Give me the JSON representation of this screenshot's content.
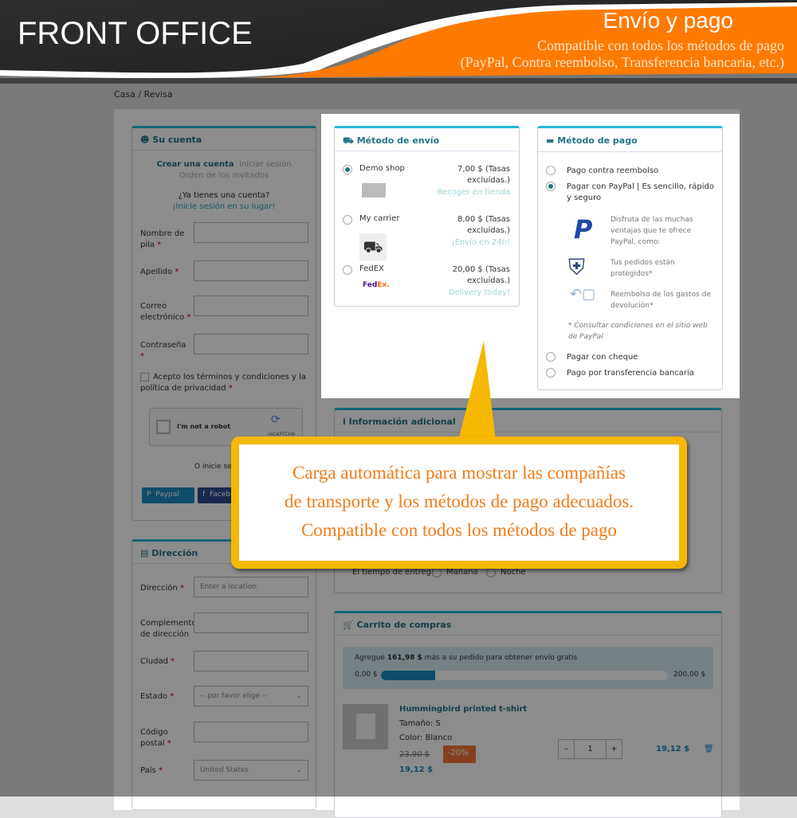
{
  "header": {
    "title": "FRONT OFFICE",
    "feature": "Envío y pago",
    "subtitle_line1": "Compatible con todos los métodos de pago",
    "subtitle_line2": "(PayPal, Contra reembolso, Transferencia bancaria, etc.)"
  },
  "breadcrumb": {
    "home": "Casa",
    "sep": "/",
    "current": "Revisa"
  },
  "account": {
    "title": "Su cuenta",
    "tab_create": "Crear una cuenta",
    "tab_login": "Iniciar sesión",
    "tab_guest": "Orden de los invitados",
    "have_account": "¿Ya tienes una cuenta?",
    "login_link": "¡Inicie sesión en su lugar!",
    "fields": [
      {
        "label": "Nombre de pila"
      },
      {
        "label": "Apellido"
      },
      {
        "label": "Correo electrónico"
      },
      {
        "label": "Contraseña"
      }
    ],
    "terms": "Acepto los términos y condiciones y la política de privacidad",
    "captcha_label": "I'm not a robot",
    "captcha_brand": "reCAPTCHA",
    "social_prompt": "O inicie sesión con",
    "paypal_btn": "Paypal",
    "facebook_btn": "Facebook"
  },
  "address": {
    "title": "Dirección",
    "fields": [
      {
        "label": "Dirección",
        "placeholder": "Enter a location"
      },
      {
        "label": "Complemento de dirección"
      },
      {
        "label": "Ciudad"
      },
      {
        "label": "Estado",
        "value": "-- por favor elige --"
      },
      {
        "label": "Código postal"
      },
      {
        "label": "País",
        "value": "United States"
      }
    ]
  },
  "shipping": {
    "title": "Método de envío",
    "carriers": [
      {
        "name": "Demo shop",
        "price": "7,00 $ (Tasas excluídas.)",
        "delay": "Recoger en tienda",
        "selected": true
      },
      {
        "name": "My carrier",
        "price": "8,00 $ (Tasas excluídas.)",
        "delay": "¡Envío en 24h!",
        "selected": false
      },
      {
        "name": "FedEX",
        "price": "20,00 $ (Tasas excluídas.)",
        "delay": "Delivery today!",
        "selected": false,
        "logo": "FedEx."
      }
    ]
  },
  "payment": {
    "title": "Método de pago",
    "options": [
      "Pago contra reembolso",
      "Pagar con PayPal | Es sencillo, rápido y seguro",
      "Pagar con cheque",
      "Pago por transferencia bancaria"
    ],
    "selected": 1,
    "paypal_info": [
      "Disfruta de las muchas ventajas que te ofrece PayPal, como:",
      "Tus pedidos están protegidos*",
      "Reembolso de los gastos de devolución*"
    ],
    "paypal_note": "* Consultar condiciones en el sitio web de PayPal"
  },
  "additional": {
    "title": "Información adicional",
    "delivery_time_label": "El tiempo de entrega",
    "options": [
      "Mañana",
      "Noche"
    ]
  },
  "cart": {
    "title": "Carrito de compras",
    "free_ship_pre": "Agregue ",
    "free_ship_amount": "161,98 $",
    "free_ship_post": " más a su pedido para obtener envío gratis",
    "progress_min": "0,00 $",
    "progress_max": "200,00 $",
    "progress_value": 38.02,
    "progress_max_value": 200,
    "item": {
      "name": "Hummingbird printed t-shirt",
      "size": "Tamaño: S",
      "color": "Color: Blanco",
      "old_price": "23,90 $",
      "discount": "-20%",
      "price": "19,12 $",
      "qty": "1",
      "total": "19,12 $"
    }
  },
  "callout": {
    "line1": "Carga automática para mostrar las compañías",
    "line2": "de transporte y los métodos de pago adecuados.",
    "line3": "Compatible con todos los métodos de pago"
  },
  "colors": {
    "accent": "#24b9d7",
    "header_orange": "#ff7a00",
    "callout_yellow": "#f6b800",
    "callout_text": "#f07c1a"
  }
}
